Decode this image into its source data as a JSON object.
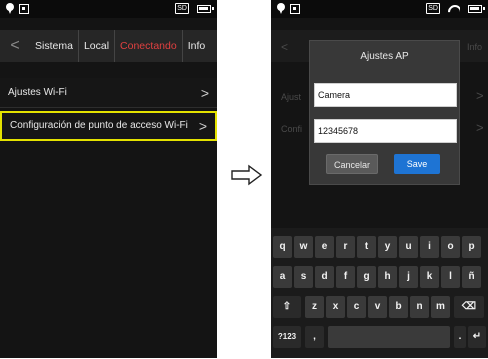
{
  "left_screen": {
    "tabs": [
      {
        "label": "Sistema"
      },
      {
        "label": "Local"
      },
      {
        "label": "Conectando"
      },
      {
        "label": "Info"
      }
    ],
    "back_glyph": "<",
    "menu": [
      {
        "label": "Ajustes Wi-Fi",
        "chevron": ">"
      },
      {
        "label": "Configuración de punto de acceso Wi-Fi",
        "chevron": ">"
      }
    ],
    "status": {
      "sd": "SD"
    }
  },
  "arrow_glyph": "⇨",
  "right_screen": {
    "status": {
      "sd": "SD"
    },
    "dialog": {
      "title": "Ajustes AP",
      "ssid_value": "Camera",
      "password_value": "12345678",
      "cancel_label": "Cancelar",
      "save_label": "Save"
    },
    "behind_labels": {
      "info": "Info",
      "ajust": "Ajust",
      "confi": "Confi"
    },
    "keyboard": {
      "row1": [
        "q",
        "w",
        "e",
        "r",
        "t",
        "y",
        "u",
        "i",
        "o",
        "p"
      ],
      "row2": [
        "a",
        "s",
        "d",
        "f",
        "g",
        "h",
        "j",
        "k",
        "l",
        "ñ"
      ],
      "row3": [
        "⇧",
        "z",
        "x",
        "c",
        "v",
        "b",
        "n",
        "m",
        "⌫"
      ],
      "row4": {
        "sym": "?123",
        "comma": ",",
        "period": ".",
        "enter": "↵"
      }
    }
  }
}
